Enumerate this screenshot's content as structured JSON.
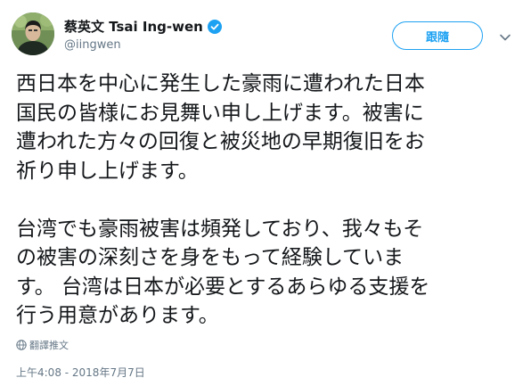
{
  "author": {
    "display_name": "蔡英文 Tsai Ing-wen",
    "handle": "@iingwen",
    "verified": true
  },
  "follow_button": {
    "label": "跟隨"
  },
  "tweet": {
    "lines": [
      "西日本を中心に発生した豪雨に遭われた日本",
      "国民の皆様にお見舞い申し上げます。被害に",
      "遭われた方々の回復と被災地の早期復旧をお",
      "祈り申し上げます。",
      "台湾でも豪雨被害は頻発しており、我々もそ",
      "の被害の深刻さを身をもって経験していま",
      "す。 台湾は日本が必要とするあらゆる支援を",
      "行う用意があります。"
    ]
  },
  "translate": {
    "label": "翻譯推文",
    "icon": "globe-icon"
  },
  "timestamp": "上午4:08 - 2018年7月7日",
  "colors": {
    "accent": "#1da1f2",
    "text": "#14171a",
    "muted": "#657786"
  }
}
